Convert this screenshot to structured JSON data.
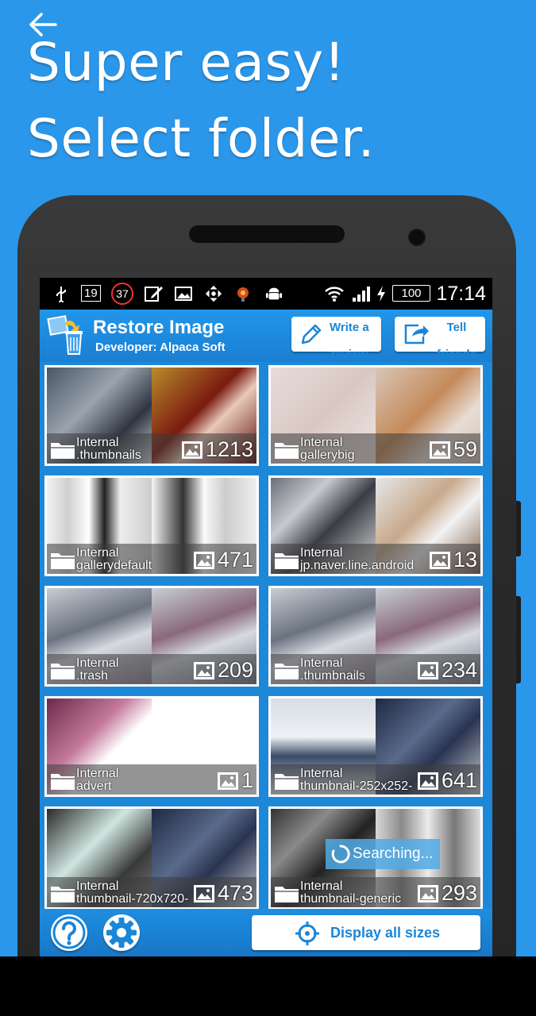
{
  "promo": {
    "headline_line1": "Super easy!",
    "headline_line2": "Select folder."
  },
  "status_bar": {
    "badge_1": "19",
    "badge_2": "37",
    "battery": "100",
    "time": "17:14"
  },
  "app_bar": {
    "title": "Restore Image",
    "developer": "Developer: Alpaca Soft",
    "write_review_line1": "Write a",
    "write_review_line2": "review",
    "tell_friends_line1": "Tell",
    "tell_friends_line2": "friends"
  },
  "folders": [
    {
      "storage": "Internal",
      "name": ".thumbnails",
      "count": "1213"
    },
    {
      "storage": "Internal",
      "name": "gallerybig",
      "count": "59"
    },
    {
      "storage": "Internal",
      "name": "gallerydefault",
      "count": "471"
    },
    {
      "storage": "Internal",
      "name": "jp.naver.line.android",
      "count": "13"
    },
    {
      "storage": "Internal",
      "name": ".trash",
      "count": "209"
    },
    {
      "storage": "Internal",
      "name": ".thumbnails",
      "count": "234"
    },
    {
      "storage": "Internal",
      "name": "advert",
      "count": "1"
    },
    {
      "storage": "Internal",
      "name": "thumbnail-252x252-",
      "count": "641"
    },
    {
      "storage": "Internal",
      "name": "thumbnail-720x720-",
      "count": "473"
    },
    {
      "storage": "Internal",
      "name": "thumbnail-generic",
      "count": "293"
    }
  ],
  "searching_label": "Searching...",
  "bottom_bar": {
    "display_all_label": "Display all sizes"
  },
  "colors": {
    "promo_background": "#2b97ea",
    "app_bar": "#1a7fd2",
    "accent_text": "#1a86d8"
  },
  "icons": [
    "back-arrow-icon",
    "usb-icon",
    "edit-icon",
    "image-icon",
    "move-icon",
    "android-icon",
    "wifi-icon",
    "signal-icon",
    "battery-icon",
    "pencil-icon",
    "share-icon",
    "folder-icon",
    "help-icon",
    "gear-icon",
    "crosshair-icon"
  ]
}
